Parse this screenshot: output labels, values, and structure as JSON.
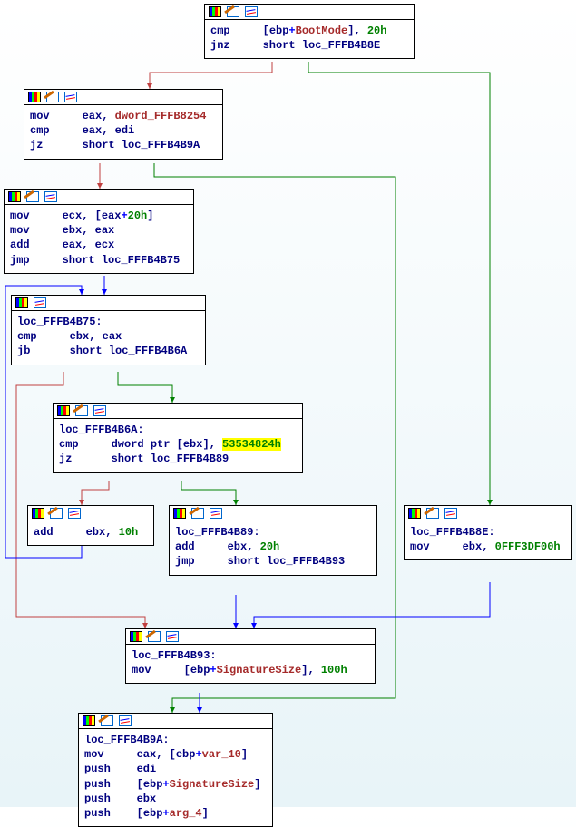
{
  "nodes": {
    "n1": {
      "lines": [
        [
          [
            "c-navy",
            "cmp     "
          ],
          [
            "c-navy",
            "["
          ],
          [
            "c-navy",
            "ebp"
          ],
          [
            "c-blue",
            "+"
          ],
          [
            "c-brown",
            "BootMode"
          ],
          [
            "c-navy",
            "], "
          ],
          [
            "c-green",
            "20h"
          ]
        ],
        [
          [
            "c-navy",
            "jnz     "
          ],
          [
            "c-navy",
            "short "
          ],
          [
            "c-navy",
            "loc_FFFB4B8E"
          ]
        ]
      ]
    },
    "n2": {
      "lines": [
        [
          [
            "c-navy",
            "mov     eax"
          ],
          [
            "c-navy",
            ", "
          ],
          [
            "c-brown",
            "dword_FFFB8254"
          ]
        ],
        [
          [
            "c-navy",
            "cmp     eax"
          ],
          [
            "c-navy",
            ", "
          ],
          [
            "c-navy",
            "edi"
          ]
        ],
        [
          [
            "c-navy",
            "jz      "
          ],
          [
            "c-navy",
            "short "
          ],
          [
            "c-navy",
            "loc_FFFB4B9A"
          ]
        ]
      ]
    },
    "n3": {
      "lines": [
        [
          [
            "c-navy",
            "mov     ecx"
          ],
          [
            "c-navy",
            ", ["
          ],
          [
            "c-navy",
            "eax"
          ],
          [
            "c-blue",
            "+"
          ],
          [
            "c-green",
            "20h"
          ],
          [
            "c-navy",
            "]"
          ]
        ],
        [
          [
            "c-navy",
            "mov     ebx"
          ],
          [
            "c-navy",
            ", "
          ],
          [
            "c-navy",
            "eax"
          ]
        ],
        [
          [
            "c-navy",
            "add     eax"
          ],
          [
            "c-navy",
            ", "
          ],
          [
            "c-navy",
            "ecx"
          ]
        ],
        [
          [
            "c-navy",
            "jmp     "
          ],
          [
            "c-navy",
            "short "
          ],
          [
            "c-navy",
            "loc_FFFB4B75"
          ]
        ]
      ]
    },
    "n4": {
      "label": "loc_FFFB4B75:",
      "lines": [
        [
          [
            "c-navy",
            "cmp     ebx"
          ],
          [
            "c-navy",
            ", "
          ],
          [
            "c-navy",
            "eax"
          ]
        ],
        [
          [
            "c-navy",
            "jb      "
          ],
          [
            "c-navy",
            "short "
          ],
          [
            "c-navy",
            "loc_FFFB4B6A"
          ]
        ]
      ]
    },
    "n5": {
      "label": "loc_FFFB4B6A:",
      "lines": [
        [
          [
            "c-navy",
            "cmp     "
          ],
          [
            "c-navy",
            "dword ptr "
          ],
          [
            "c-navy",
            "["
          ],
          [
            "c-navy",
            "ebx"
          ],
          [
            "c-navy",
            "], "
          ],
          [
            "hl",
            "53534824h"
          ]
        ],
        [
          [
            "c-navy",
            "jz      "
          ],
          [
            "c-navy",
            "short "
          ],
          [
            "c-navy",
            "loc_FFFB4B89"
          ]
        ]
      ]
    },
    "n6": {
      "lines": [
        [
          [
            "c-navy",
            "add     ebx"
          ],
          [
            "c-navy",
            ", "
          ],
          [
            "c-green",
            "10h"
          ]
        ]
      ]
    },
    "n7": {
      "label": "loc_FFFB4B89:",
      "lines": [
        [
          [
            "c-navy",
            "add     ebx"
          ],
          [
            "c-navy",
            ", "
          ],
          [
            "c-green",
            "20h"
          ]
        ],
        [
          [
            "c-navy",
            "jmp     "
          ],
          [
            "c-navy",
            "short "
          ],
          [
            "c-navy",
            "loc_FFFB4B93"
          ]
        ]
      ]
    },
    "n8": {
      "label": "loc_FFFB4B8E:",
      "lines": [
        [
          [
            "c-navy",
            "mov     ebx"
          ],
          [
            "c-navy",
            ", "
          ],
          [
            "c-green",
            "0FFF3DF00h"
          ]
        ]
      ]
    },
    "n9": {
      "label": "loc_FFFB4B93:",
      "lines": [
        [
          [
            "c-navy",
            "mov     "
          ],
          [
            "c-navy",
            "["
          ],
          [
            "c-navy",
            "ebp"
          ],
          [
            "c-blue",
            "+"
          ],
          [
            "c-brown",
            "SignatureSize"
          ],
          [
            "c-navy",
            "], "
          ],
          [
            "c-green",
            "100h"
          ]
        ]
      ]
    },
    "n10": {
      "label": "loc_FFFB4B9A:",
      "lines": [
        [
          [
            "c-navy",
            "mov     eax"
          ],
          [
            "c-navy",
            ", ["
          ],
          [
            "c-navy",
            "ebp"
          ],
          [
            "c-blue",
            "+"
          ],
          [
            "c-brown",
            "var_10"
          ],
          [
            "c-navy",
            "]"
          ]
        ],
        [
          [
            "c-navy",
            "push    edi"
          ]
        ],
        [
          [
            "c-navy",
            "push    "
          ],
          [
            "c-navy",
            "["
          ],
          [
            "c-navy",
            "ebp"
          ],
          [
            "c-blue",
            "+"
          ],
          [
            "c-brown",
            "SignatureSize"
          ],
          [
            "c-navy",
            "]"
          ]
        ],
        [
          [
            "c-navy",
            "push    ebx"
          ]
        ],
        [
          [
            "c-navy",
            "push    "
          ],
          [
            "c-navy",
            "["
          ],
          [
            "c-navy",
            "ebp"
          ],
          [
            "c-blue",
            "+"
          ],
          [
            "c-brown",
            "arg_4"
          ],
          [
            "c-navy",
            "]"
          ]
        ]
      ]
    }
  }
}
